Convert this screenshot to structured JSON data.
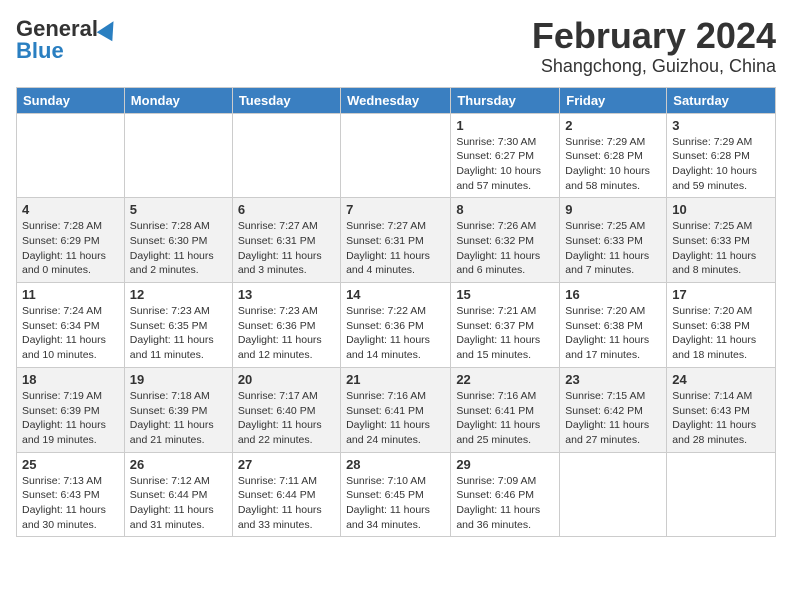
{
  "header": {
    "logo_general": "General",
    "logo_blue": "Blue",
    "title_month": "February 2024",
    "title_location": "Shangchong, Guizhou, China"
  },
  "weekdays": [
    "Sunday",
    "Monday",
    "Tuesday",
    "Wednesday",
    "Thursday",
    "Friday",
    "Saturday"
  ],
  "weeks": [
    [
      {
        "day": "",
        "info": ""
      },
      {
        "day": "",
        "info": ""
      },
      {
        "day": "",
        "info": ""
      },
      {
        "day": "",
        "info": ""
      },
      {
        "day": "1",
        "info": "Sunrise: 7:30 AM\nSunset: 6:27 PM\nDaylight: 10 hours and 57 minutes."
      },
      {
        "day": "2",
        "info": "Sunrise: 7:29 AM\nSunset: 6:28 PM\nDaylight: 10 hours and 58 minutes."
      },
      {
        "day": "3",
        "info": "Sunrise: 7:29 AM\nSunset: 6:28 PM\nDaylight: 10 hours and 59 minutes."
      }
    ],
    [
      {
        "day": "4",
        "info": "Sunrise: 7:28 AM\nSunset: 6:29 PM\nDaylight: 11 hours and 0 minutes."
      },
      {
        "day": "5",
        "info": "Sunrise: 7:28 AM\nSunset: 6:30 PM\nDaylight: 11 hours and 2 minutes."
      },
      {
        "day": "6",
        "info": "Sunrise: 7:27 AM\nSunset: 6:31 PM\nDaylight: 11 hours and 3 minutes."
      },
      {
        "day": "7",
        "info": "Sunrise: 7:27 AM\nSunset: 6:31 PM\nDaylight: 11 hours and 4 minutes."
      },
      {
        "day": "8",
        "info": "Sunrise: 7:26 AM\nSunset: 6:32 PM\nDaylight: 11 hours and 6 minutes."
      },
      {
        "day": "9",
        "info": "Sunrise: 7:25 AM\nSunset: 6:33 PM\nDaylight: 11 hours and 7 minutes."
      },
      {
        "day": "10",
        "info": "Sunrise: 7:25 AM\nSunset: 6:33 PM\nDaylight: 11 hours and 8 minutes."
      }
    ],
    [
      {
        "day": "11",
        "info": "Sunrise: 7:24 AM\nSunset: 6:34 PM\nDaylight: 11 hours and 10 minutes."
      },
      {
        "day": "12",
        "info": "Sunrise: 7:23 AM\nSunset: 6:35 PM\nDaylight: 11 hours and 11 minutes."
      },
      {
        "day": "13",
        "info": "Sunrise: 7:23 AM\nSunset: 6:36 PM\nDaylight: 11 hours and 12 minutes."
      },
      {
        "day": "14",
        "info": "Sunrise: 7:22 AM\nSunset: 6:36 PM\nDaylight: 11 hours and 14 minutes."
      },
      {
        "day": "15",
        "info": "Sunrise: 7:21 AM\nSunset: 6:37 PM\nDaylight: 11 hours and 15 minutes."
      },
      {
        "day": "16",
        "info": "Sunrise: 7:20 AM\nSunset: 6:38 PM\nDaylight: 11 hours and 17 minutes."
      },
      {
        "day": "17",
        "info": "Sunrise: 7:20 AM\nSunset: 6:38 PM\nDaylight: 11 hours and 18 minutes."
      }
    ],
    [
      {
        "day": "18",
        "info": "Sunrise: 7:19 AM\nSunset: 6:39 PM\nDaylight: 11 hours and 19 minutes."
      },
      {
        "day": "19",
        "info": "Sunrise: 7:18 AM\nSunset: 6:39 PM\nDaylight: 11 hours and 21 minutes."
      },
      {
        "day": "20",
        "info": "Sunrise: 7:17 AM\nSunset: 6:40 PM\nDaylight: 11 hours and 22 minutes."
      },
      {
        "day": "21",
        "info": "Sunrise: 7:16 AM\nSunset: 6:41 PM\nDaylight: 11 hours and 24 minutes."
      },
      {
        "day": "22",
        "info": "Sunrise: 7:16 AM\nSunset: 6:41 PM\nDaylight: 11 hours and 25 minutes."
      },
      {
        "day": "23",
        "info": "Sunrise: 7:15 AM\nSunset: 6:42 PM\nDaylight: 11 hours and 27 minutes."
      },
      {
        "day": "24",
        "info": "Sunrise: 7:14 AM\nSunset: 6:43 PM\nDaylight: 11 hours and 28 minutes."
      }
    ],
    [
      {
        "day": "25",
        "info": "Sunrise: 7:13 AM\nSunset: 6:43 PM\nDaylight: 11 hours and 30 minutes."
      },
      {
        "day": "26",
        "info": "Sunrise: 7:12 AM\nSunset: 6:44 PM\nDaylight: 11 hours and 31 minutes."
      },
      {
        "day": "27",
        "info": "Sunrise: 7:11 AM\nSunset: 6:44 PM\nDaylight: 11 hours and 33 minutes."
      },
      {
        "day": "28",
        "info": "Sunrise: 7:10 AM\nSunset: 6:45 PM\nDaylight: 11 hours and 34 minutes."
      },
      {
        "day": "29",
        "info": "Sunrise: 7:09 AM\nSunset: 6:46 PM\nDaylight: 11 hours and 36 minutes."
      },
      {
        "day": "",
        "info": ""
      },
      {
        "day": "",
        "info": ""
      }
    ]
  ]
}
